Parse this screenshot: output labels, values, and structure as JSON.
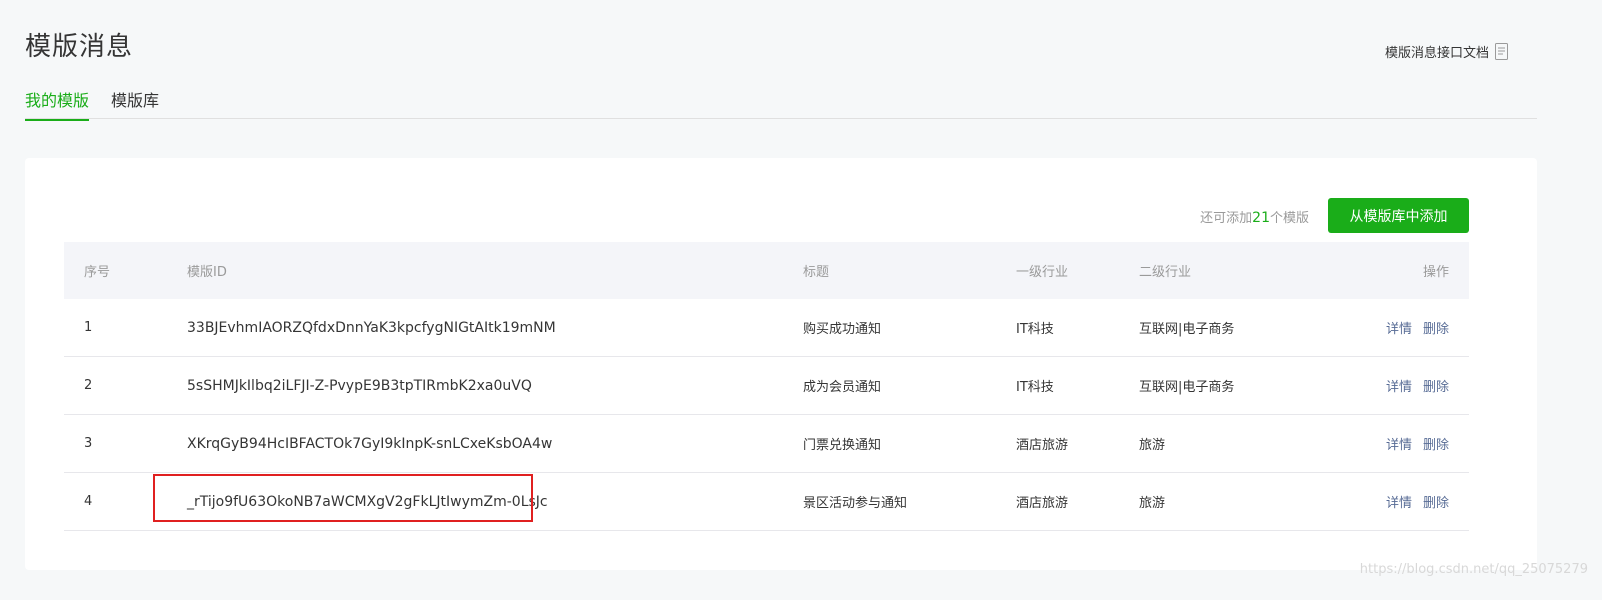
{
  "header": {
    "title": "模版消息",
    "doc_link": "模版消息接口文档",
    "doc_icon": "document-icon"
  },
  "tabs": [
    {
      "label": "我的模版",
      "active": true
    },
    {
      "label": "模版库",
      "active": false
    }
  ],
  "toolbar": {
    "quota_prefix": "还可添加",
    "quota_count": "21",
    "quota_suffix": "个模版",
    "add_button": "从模版库中添加"
  },
  "table": {
    "headers": [
      "序号",
      "模版ID",
      "标题",
      "一级行业",
      "二级行业",
      "操作"
    ],
    "rows": [
      {
        "idx": "1",
        "id": "33BJEvhmIAORZQfdxDnnYaK3kpcfygNIGtAItk19mNM",
        "title": "购买成功通知",
        "industry1": "IT科技",
        "industry2": "互联网|电子商务",
        "detail": "详情",
        "delete": "删除"
      },
      {
        "idx": "2",
        "id": "5sSHMJkIlbq2iLFJI-Z-PvypE9B3tpTIRmbK2xa0uVQ",
        "title": "成为会员通知",
        "industry1": "IT科技",
        "industry2": "互联网|电子商务",
        "detail": "详情",
        "delete": "删除"
      },
      {
        "idx": "3",
        "id": "XKrqGyB94HcIBFACTOk7GyI9kInpK-snLCxeKsbOA4w",
        "title": "门票兑换通知",
        "industry1": "酒店旅游",
        "industry2": "旅游",
        "detail": "详情",
        "delete": "删除"
      },
      {
        "idx": "4",
        "id": "_rTijo9fU63OkoNB7aWCMXgV2gFkLJtIwymZm-0LsJc",
        "title": "景区活动参与通知",
        "industry1": "酒店旅游",
        "industry2": "旅游",
        "detail": "详情",
        "delete": "删除"
      }
    ]
  },
  "watermark": "https://blog.csdn.net/qq_25075279",
  "colors": {
    "accent": "#1aad19",
    "link": "#576b95",
    "highlight": "#e02020"
  }
}
